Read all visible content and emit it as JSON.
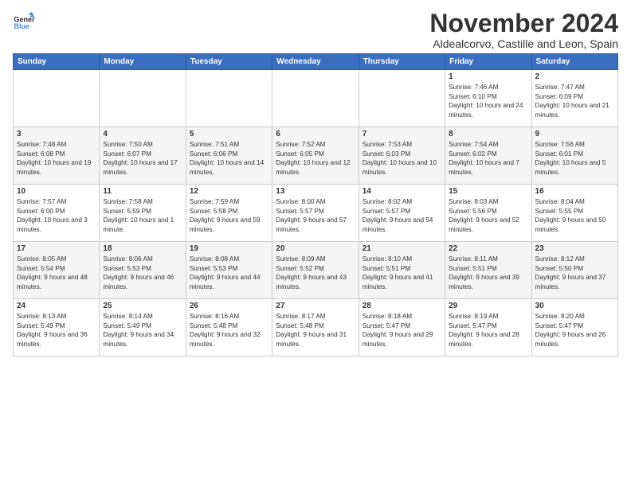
{
  "header": {
    "logo_general": "General",
    "logo_blue": "Blue",
    "month_title": "November 2024",
    "subtitle": "Aldealcorvo, Castille and Leon, Spain"
  },
  "weekdays": [
    "Sunday",
    "Monday",
    "Tuesday",
    "Wednesday",
    "Thursday",
    "Friday",
    "Saturday"
  ],
  "weeks": [
    [
      {
        "day": "",
        "info": ""
      },
      {
        "day": "",
        "info": ""
      },
      {
        "day": "",
        "info": ""
      },
      {
        "day": "",
        "info": ""
      },
      {
        "day": "",
        "info": ""
      },
      {
        "day": "1",
        "info": "Sunrise: 7:46 AM\nSunset: 6:10 PM\nDaylight: 10 hours and 24 minutes."
      },
      {
        "day": "2",
        "info": "Sunrise: 7:47 AM\nSunset: 6:09 PM\nDaylight: 10 hours and 21 minutes."
      }
    ],
    [
      {
        "day": "3",
        "info": "Sunrise: 7:48 AM\nSunset: 6:08 PM\nDaylight: 10 hours and 19 minutes."
      },
      {
        "day": "4",
        "info": "Sunrise: 7:50 AM\nSunset: 6:07 PM\nDaylight: 10 hours and 17 minutes."
      },
      {
        "day": "5",
        "info": "Sunrise: 7:51 AM\nSunset: 6:06 PM\nDaylight: 10 hours and 14 minutes."
      },
      {
        "day": "6",
        "info": "Sunrise: 7:52 AM\nSunset: 6:05 PM\nDaylight: 10 hours and 12 minutes."
      },
      {
        "day": "7",
        "info": "Sunrise: 7:53 AM\nSunset: 6:03 PM\nDaylight: 10 hours and 10 minutes."
      },
      {
        "day": "8",
        "info": "Sunrise: 7:54 AM\nSunset: 6:02 PM\nDaylight: 10 hours and 7 minutes."
      },
      {
        "day": "9",
        "info": "Sunrise: 7:56 AM\nSunset: 6:01 PM\nDaylight: 10 hours and 5 minutes."
      }
    ],
    [
      {
        "day": "10",
        "info": "Sunrise: 7:57 AM\nSunset: 6:00 PM\nDaylight: 10 hours and 3 minutes."
      },
      {
        "day": "11",
        "info": "Sunrise: 7:58 AM\nSunset: 5:59 PM\nDaylight: 10 hours and 1 minute."
      },
      {
        "day": "12",
        "info": "Sunrise: 7:59 AM\nSunset: 5:58 PM\nDaylight: 9 hours and 59 minutes."
      },
      {
        "day": "13",
        "info": "Sunrise: 8:00 AM\nSunset: 5:57 PM\nDaylight: 9 hours and 57 minutes."
      },
      {
        "day": "14",
        "info": "Sunrise: 8:02 AM\nSunset: 5:57 PM\nDaylight: 9 hours and 54 minutes."
      },
      {
        "day": "15",
        "info": "Sunrise: 8:03 AM\nSunset: 5:56 PM\nDaylight: 9 hours and 52 minutes."
      },
      {
        "day": "16",
        "info": "Sunrise: 8:04 AM\nSunset: 5:55 PM\nDaylight: 9 hours and 50 minutes."
      }
    ],
    [
      {
        "day": "17",
        "info": "Sunrise: 8:05 AM\nSunset: 5:54 PM\nDaylight: 9 hours and 48 minutes."
      },
      {
        "day": "18",
        "info": "Sunrise: 8:06 AM\nSunset: 5:53 PM\nDaylight: 9 hours and 46 minutes."
      },
      {
        "day": "19",
        "info": "Sunrise: 8:08 AM\nSunset: 5:53 PM\nDaylight: 9 hours and 44 minutes."
      },
      {
        "day": "20",
        "info": "Sunrise: 8:09 AM\nSunset: 5:52 PM\nDaylight: 9 hours and 43 minutes."
      },
      {
        "day": "21",
        "info": "Sunrise: 8:10 AM\nSunset: 5:51 PM\nDaylight: 9 hours and 41 minutes."
      },
      {
        "day": "22",
        "info": "Sunrise: 8:11 AM\nSunset: 5:51 PM\nDaylight: 9 hours and 39 minutes."
      },
      {
        "day": "23",
        "info": "Sunrise: 8:12 AM\nSunset: 5:50 PM\nDaylight: 9 hours and 37 minutes."
      }
    ],
    [
      {
        "day": "24",
        "info": "Sunrise: 8:13 AM\nSunset: 5:49 PM\nDaylight: 9 hours and 36 minutes."
      },
      {
        "day": "25",
        "info": "Sunrise: 8:14 AM\nSunset: 5:49 PM\nDaylight: 9 hours and 34 minutes."
      },
      {
        "day": "26",
        "info": "Sunrise: 8:16 AM\nSunset: 5:48 PM\nDaylight: 9 hours and 32 minutes."
      },
      {
        "day": "27",
        "info": "Sunrise: 8:17 AM\nSunset: 5:48 PM\nDaylight: 9 hours and 31 minutes."
      },
      {
        "day": "28",
        "info": "Sunrise: 8:18 AM\nSunset: 5:47 PM\nDaylight: 9 hours and 29 minutes."
      },
      {
        "day": "29",
        "info": "Sunrise: 8:19 AM\nSunset: 5:47 PM\nDaylight: 9 hours and 28 minutes."
      },
      {
        "day": "30",
        "info": "Sunrise: 8:20 AM\nSunset: 5:47 PM\nDaylight: 9 hours and 26 minutes."
      }
    ]
  ]
}
